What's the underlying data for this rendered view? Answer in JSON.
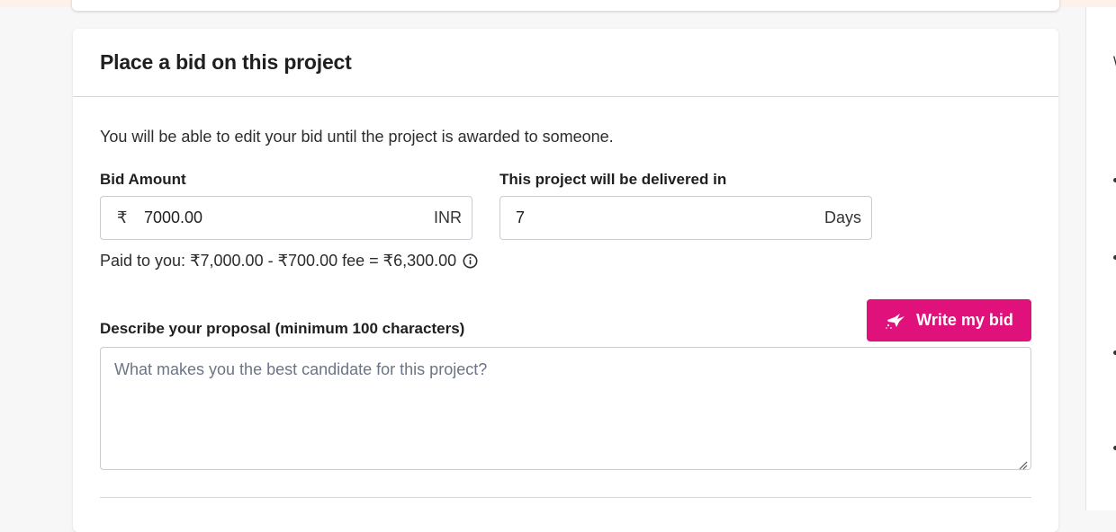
{
  "card": {
    "title": "Place a bid on this project",
    "intro": "You will be able to edit your bid until the project is awarded to someone."
  },
  "bid": {
    "label": "Bid Amount",
    "currency_symbol": "₹",
    "value": "7000.00",
    "currency": "INR"
  },
  "delivery": {
    "label": "This project will be delivered in",
    "value": "7",
    "unit": "Days"
  },
  "paid_summary": "Paid to you: ₹7,000.00 - ₹700.00 fee = ₹6,300.00",
  "proposal": {
    "label": "Describe your proposal (minimum 100 characters)",
    "placeholder": "What makes you the best candidate for this project?",
    "ai_button_label": "Write my bid"
  },
  "colors": {
    "accent": "#e0117a",
    "border": "#c9ccd1"
  },
  "icons": {
    "info": "info-circle-icon",
    "ai": "hummingbird-sparkle-icon",
    "resize": "resize-grip-icon"
  }
}
